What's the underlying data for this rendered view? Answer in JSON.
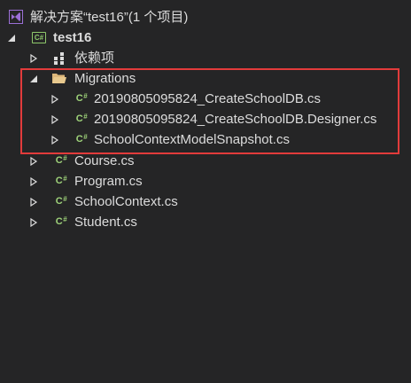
{
  "solution": {
    "label": "解决方案“test16”(1 个项目)",
    "icon": "visual-studio-solution-icon"
  },
  "project": {
    "label": "test16",
    "icon": "csharp-project-icon",
    "icon_text": "C#"
  },
  "dependencies": {
    "label": "依赖项",
    "icon": "dependencies-icon"
  },
  "migrations": {
    "label": "Migrations",
    "icon": "folder-open-icon",
    "files": [
      {
        "label": "20190805095824_CreateSchoolDB.cs"
      },
      {
        "label": "20190805095824_CreateSchoolDB.Designer.cs"
      },
      {
        "label": "SchoolContextModelSnapshot.cs"
      }
    ]
  },
  "files": [
    {
      "label": "Course.cs"
    },
    {
      "label": "Program.cs"
    },
    {
      "label": "SchoolContext.cs"
    },
    {
      "label": "Student.cs"
    }
  ],
  "csharp_icon_text": "C",
  "csharp_icon_sharp": "#",
  "colors": {
    "background": "#252526",
    "text": "#dcdcdc",
    "cs_icon": "#9fd37a",
    "folder": "#dcb67a",
    "highlight_border": "#e23b3b",
    "vs_purple": "#9b6fd6"
  }
}
